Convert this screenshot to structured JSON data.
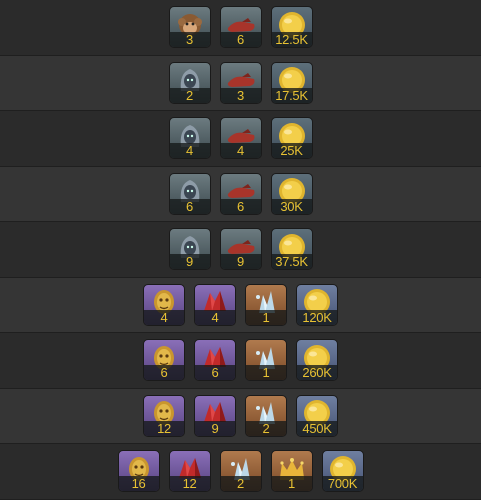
{
  "icons": {
    "monkey": "monkey-portrait-icon",
    "ghost": "hooded-ghost-icon",
    "slipper": "red-slipper-icon",
    "coin": "gold-coin-icon",
    "gold_mask": "gold-mask-icon",
    "red_crystal": "red-crystal-icon",
    "ice_crystal": "ice-crystal-icon",
    "crown": "crown-icon"
  },
  "colors": {
    "count_text": "#e8c233"
  },
  "rows": [
    {
      "items": [
        {
          "icon": "monkey",
          "count": "3"
        },
        {
          "icon": "slipper",
          "count": "6"
        },
        {
          "icon": "coin",
          "count": "12.5K"
        }
      ]
    },
    {
      "items": [
        {
          "icon": "ghost",
          "count": "2"
        },
        {
          "icon": "slipper",
          "count": "3"
        },
        {
          "icon": "coin",
          "count": "17.5K"
        }
      ]
    },
    {
      "items": [
        {
          "icon": "ghost",
          "count": "4"
        },
        {
          "icon": "slipper",
          "count": "4"
        },
        {
          "icon": "coin",
          "count": "25K"
        }
      ]
    },
    {
      "items": [
        {
          "icon": "ghost",
          "count": "6"
        },
        {
          "icon": "slipper",
          "count": "6"
        },
        {
          "icon": "coin",
          "count": "30K"
        }
      ]
    },
    {
      "items": [
        {
          "icon": "ghost",
          "count": "9"
        },
        {
          "icon": "slipper",
          "count": "9"
        },
        {
          "icon": "coin",
          "count": "37.5K"
        }
      ]
    },
    {
      "items": [
        {
          "icon": "gold_mask",
          "count": "4"
        },
        {
          "icon": "red_crystal",
          "count": "4"
        },
        {
          "icon": "ice_crystal",
          "count": "1"
        },
        {
          "icon": "coin",
          "count": "120K"
        }
      ]
    },
    {
      "items": [
        {
          "icon": "gold_mask",
          "count": "6"
        },
        {
          "icon": "red_crystal",
          "count": "6"
        },
        {
          "icon": "ice_crystal",
          "count": "1"
        },
        {
          "icon": "coin",
          "count": "260K"
        }
      ]
    },
    {
      "items": [
        {
          "icon": "gold_mask",
          "count": "12"
        },
        {
          "icon": "red_crystal",
          "count": "9"
        },
        {
          "icon": "ice_crystal",
          "count": "2"
        },
        {
          "icon": "coin",
          "count": "450K"
        }
      ]
    },
    {
      "items": [
        {
          "icon": "gold_mask",
          "count": "16"
        },
        {
          "icon": "red_crystal",
          "count": "12"
        },
        {
          "icon": "ice_crystal",
          "count": "2"
        },
        {
          "icon": "crown",
          "count": "1"
        },
        {
          "icon": "coin",
          "count": "700K"
        }
      ]
    }
  ]
}
